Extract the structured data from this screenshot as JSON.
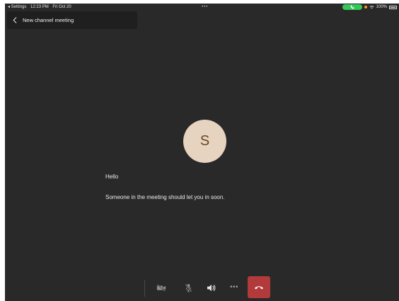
{
  "status_bar": {
    "back_app": "◂ Settings",
    "time": "12:23 PM",
    "date": "Fri Oct 20",
    "dots": "•••",
    "battery": "100%"
  },
  "header": {
    "title": "New channel meeting"
  },
  "lobby": {
    "avatar_initial": "S",
    "greeting": "Hello",
    "message": "Someone in the meeting should let you in soon."
  },
  "controls": {
    "more_label": "•••"
  },
  "icons": {
    "back": "chevron-left-icon",
    "camera_off": "camera-off-icon",
    "mic_off": "mic-off-icon",
    "speaker": "speaker-icon",
    "more": "more-icon",
    "hang_up": "hang-up-icon"
  },
  "colors": {
    "background": "#292929",
    "header_card": "#1f1f1f",
    "avatar_bg": "#e6d3c0",
    "avatar_text": "#6b4728",
    "hangup": "#b23a3a",
    "call_pill": "#34c759"
  }
}
